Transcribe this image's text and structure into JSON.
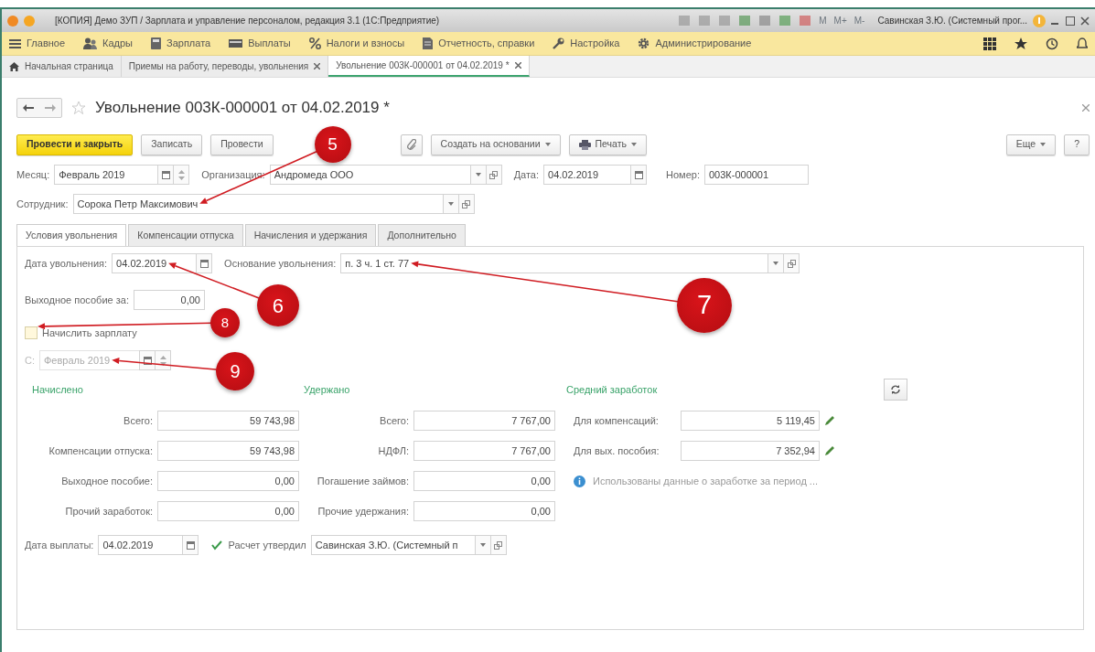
{
  "window": {
    "title": "[КОПИЯ] Демо ЗУП / Зарплата и управление персоналом, редакция 3.1  (1С:Предприятие)",
    "memory_keys": [
      "M",
      "M+",
      "M-"
    ],
    "user": "Савинская З.Ю. (Системный прог..."
  },
  "sections": [
    {
      "label": "Главное",
      "kind": "menu"
    },
    {
      "label": "Кадры",
      "kind": "people"
    },
    {
      "label": "Зарплата",
      "kind": "calc"
    },
    {
      "label": "Выплаты",
      "kind": "money"
    },
    {
      "label": "Налоги и взносы",
      "kind": "percent"
    },
    {
      "label": "Отчетность, справки",
      "kind": "report"
    },
    {
      "label": "Настройка",
      "kind": "wrench"
    },
    {
      "label": "Администрирование",
      "kind": "gear"
    }
  ],
  "open_tabs": [
    {
      "label": "Начальная страница",
      "kind": "home",
      "selected": false
    },
    {
      "label": "Приемы на работу, переводы, увольнения",
      "kind": "closable",
      "selected": false
    },
    {
      "label": "Увольнение 003К-000001 от 04.02.2019 *",
      "kind": "closable",
      "selected": true
    }
  ],
  "document": {
    "title": "Увольнение 003К-000001 от 04.02.2019 *",
    "commands": [
      {
        "label": "Провести и закрыть",
        "kind": "default"
      },
      {
        "label": "Записать",
        "kind": "plain"
      },
      {
        "label": "Провести",
        "kind": "plain"
      },
      {
        "kind": "clip"
      },
      {
        "label": "Создать на основании",
        "kind": "menu"
      },
      {
        "label": "Печать",
        "kind": "print"
      }
    ],
    "more_commands": [
      {
        "label": "Еще",
        "kind": "menu"
      },
      {
        "label": "?",
        "kind": "plain"
      }
    ],
    "month": {
      "label": "Месяц:",
      "value": "Февраль 2019"
    },
    "organization": {
      "label": "Организация:",
      "value": "Андромеда ООО"
    },
    "date": {
      "label": "Дата:",
      "value": "04.02.2019"
    },
    "number": {
      "label": "Номер:",
      "value": "003К-000001"
    },
    "employee": {
      "label": "Сотрудник:",
      "value": "Сорока Петр Максимович"
    },
    "tabs": [
      {
        "label": "Условия увольнения",
        "selected": true
      },
      {
        "label": "Компенсации отпуска",
        "selected": false
      },
      {
        "label": "Начисления и удержания",
        "selected": false
      },
      {
        "label": "Дополнительно",
        "selected": false
      }
    ],
    "dismissal_date": {
      "label": "Дата увольнения:",
      "value": "04.02.2019"
    },
    "dismissal_basis": {
      "label": "Основание увольнения:",
      "value": "п. 3 ч. 1 ст. 77"
    },
    "severance": {
      "label": "Выходное пособие за:",
      "value": "0,00"
    },
    "accrue_salary": {
      "label": "Начислить зарплату",
      "checked": false
    },
    "from_month": {
      "label": "С:",
      "value": "Февраль 2019",
      "disabled": true
    },
    "accrued": {
      "title": "Начислено",
      "rows": [
        {
          "label": "Всего:",
          "value": "59 743,98"
        },
        {
          "label": "Компенсации отпуска:",
          "value": "59 743,98"
        },
        {
          "label": "Выходное пособие:",
          "value": "0,00"
        },
        {
          "label": "Прочий заработок:",
          "value": "0,00"
        }
      ]
    },
    "withheld": {
      "title": "Удержано",
      "rows": [
        {
          "label": "Всего:",
          "value": "7 767,00"
        },
        {
          "label": "НДФЛ:",
          "value": "7 767,00"
        },
        {
          "label": "Погашение займов:",
          "value": "0,00"
        },
        {
          "label": "Прочие удержания:",
          "value": "0,00"
        }
      ]
    },
    "average_earnings": {
      "title": "Средний заработок",
      "rows": [
        {
          "label": "Для компенсаций:",
          "value": "5 119,45"
        },
        {
          "label": "Для вых. пособия:",
          "value": "7 352,94"
        }
      ],
      "note": "Использованы данные о заработке за период ..."
    },
    "payment_date": {
      "label": "Дата выплаты:",
      "value": "04.02.2019"
    },
    "approved": {
      "label": "Расчет утвердил",
      "checked": true,
      "value": "Савинская З.Ю. (Системный п"
    }
  },
  "callouts": [
    {
      "number": "5"
    },
    {
      "number": "6"
    },
    {
      "number": "7"
    },
    {
      "number": "8"
    },
    {
      "number": "9"
    }
  ]
}
